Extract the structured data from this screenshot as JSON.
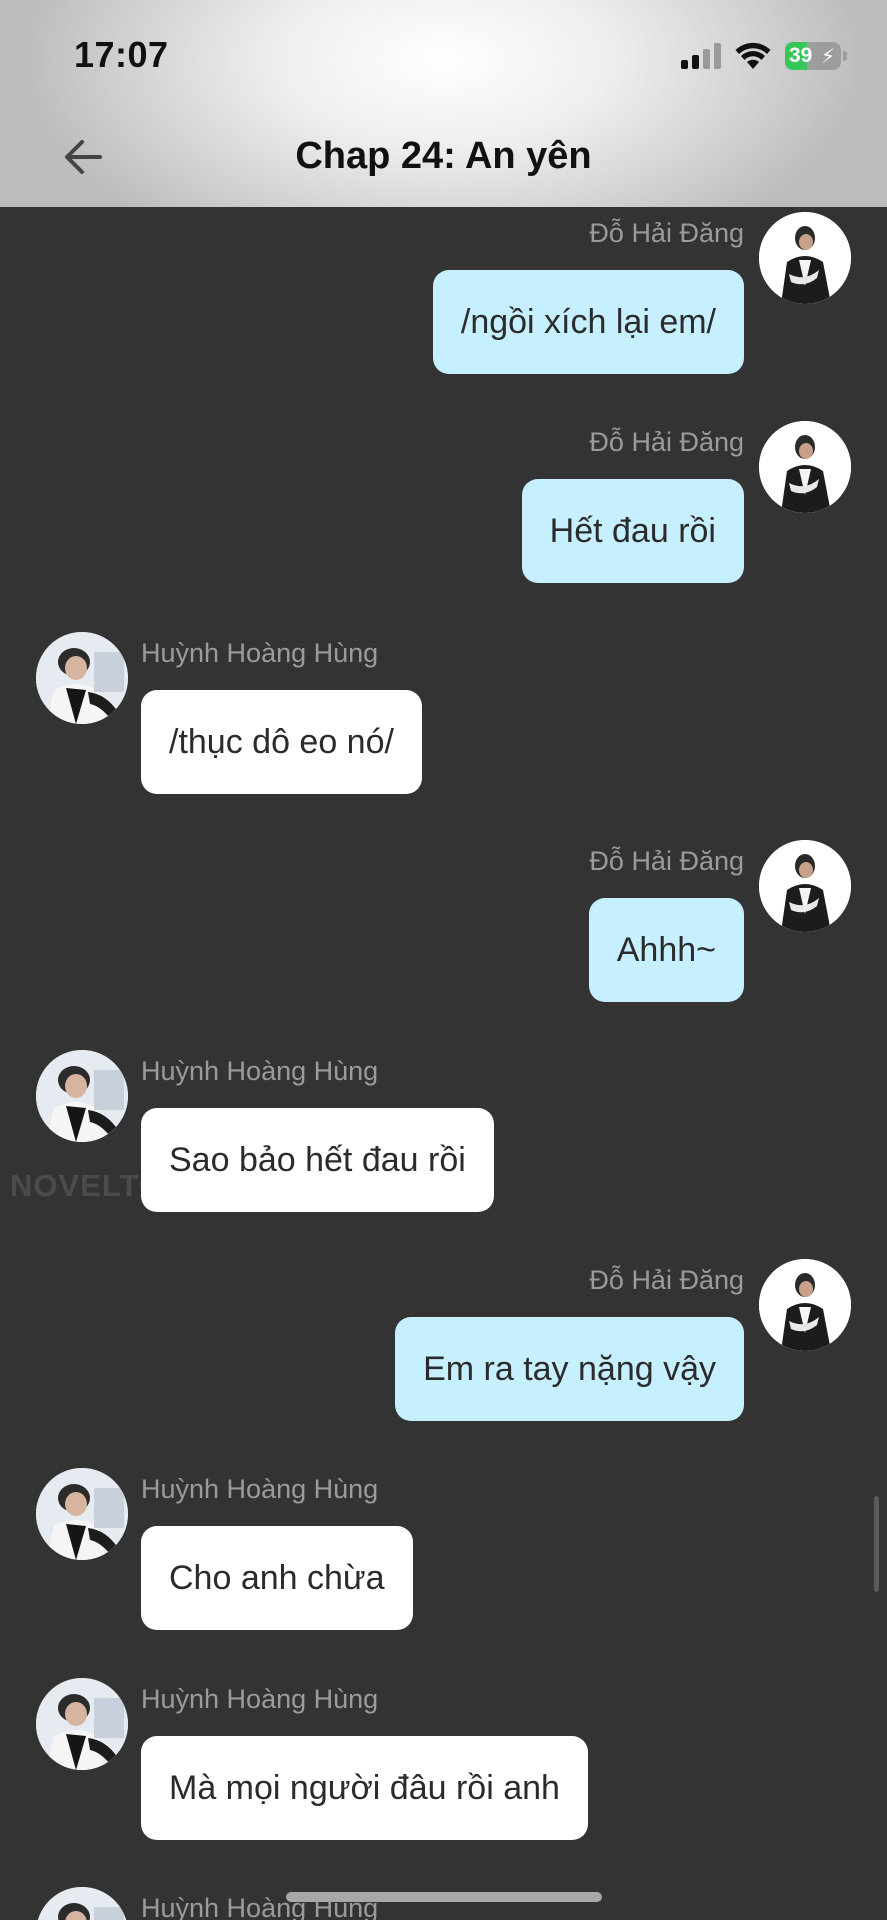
{
  "status_bar": {
    "time": "17:07",
    "battery": "39"
  },
  "header": {
    "title": "Chap 24: An yên"
  },
  "messages": [
    {
      "side": "right",
      "name": "Đỗ Hải Đăng",
      "text": "/ngồi xích lại em/"
    },
    {
      "side": "right",
      "name": "Đỗ Hải Đăng",
      "text": "Hết đau rồi"
    },
    {
      "side": "left",
      "name": "Huỳnh Hoàng Hùng",
      "text": "/thục dô eo nó/"
    },
    {
      "side": "right",
      "name": "Đỗ Hải Đăng",
      "text": "Ahhh~"
    },
    {
      "side": "left",
      "name": "Huỳnh Hoàng Hùng",
      "text": "Sao bảo hết đau rồi"
    },
    {
      "side": "right",
      "name": "Đỗ Hải Đăng",
      "text": "Em ra tay nặng vậy"
    },
    {
      "side": "left",
      "name": "Huỳnh Hoàng Hùng",
      "text": "Cho anh chừa"
    },
    {
      "side": "left",
      "name": "Huỳnh Hoàng Hùng",
      "text": "Mà mọi người đâu rồi anh"
    },
    {
      "side": "left",
      "name": "Huỳnh Hoàng Hùng",
      "text": ""
    }
  ],
  "watermark": "NOVELTOON"
}
